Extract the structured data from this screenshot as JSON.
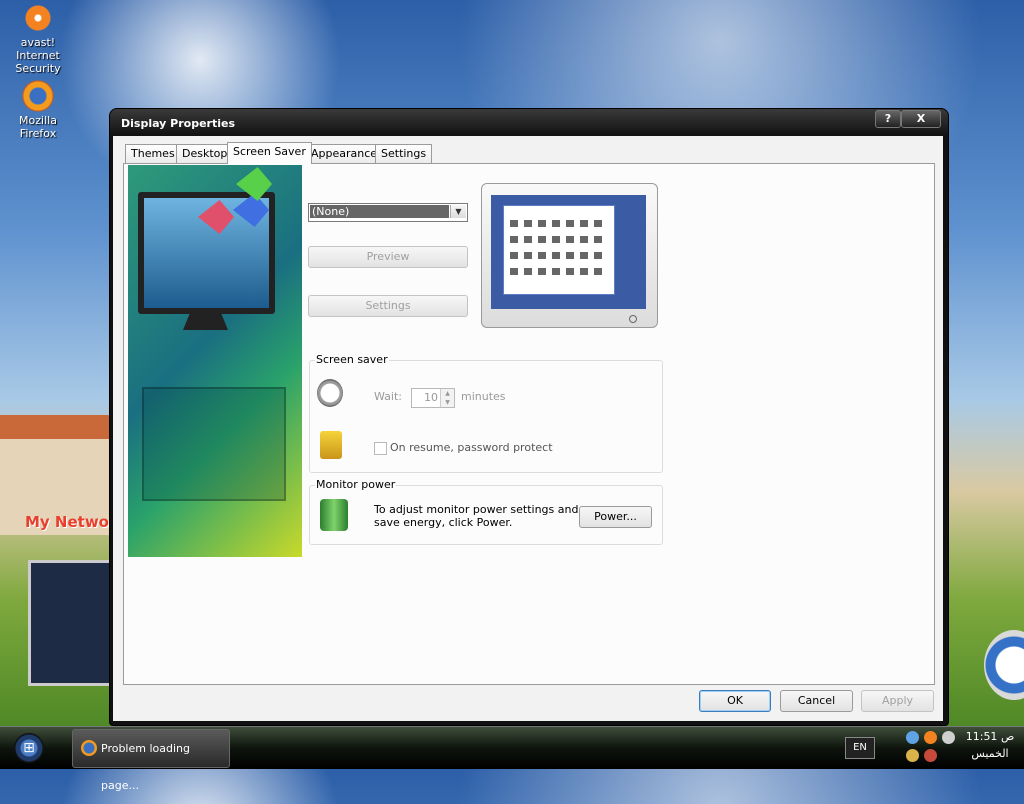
{
  "desktop": {
    "icons": [
      {
        "label": "avast! Internet Security"
      },
      {
        "label": "Mozilla Firefox"
      }
    ],
    "wallpaper_text": "My Netwo"
  },
  "dialog": {
    "title": "Display Properties",
    "help_button": "?",
    "close_button": "X",
    "tabs": [
      {
        "label": "Themes"
      },
      {
        "label": "Desktop"
      },
      {
        "label": "Screen Saver"
      },
      {
        "label": "Appearance"
      },
      {
        "label": "Settings"
      }
    ],
    "active_tab": "Screen Saver",
    "screensaver": {
      "selected": "(None)",
      "preview_button": "Preview",
      "settings_button": "Settings"
    },
    "screen_saver_group": {
      "label": "Screen saver",
      "wait_label": "Wait:",
      "wait_value": "10",
      "minutes_label": "minutes",
      "password_label": "On resume, password protect",
      "password_checked": false
    },
    "monitor_power_group": {
      "label": "Monitor power",
      "description": "To adjust monitor power settings and save energy, click Power.",
      "power_button": "Power..."
    },
    "footer": {
      "ok": "OK",
      "cancel": "Cancel",
      "apply": "Apply"
    }
  },
  "taskbar": {
    "task_label": "Problem loading page...",
    "language": "EN",
    "clock_time": "11:51",
    "clock_ampm": "ص",
    "clock_day": "الخميس"
  }
}
